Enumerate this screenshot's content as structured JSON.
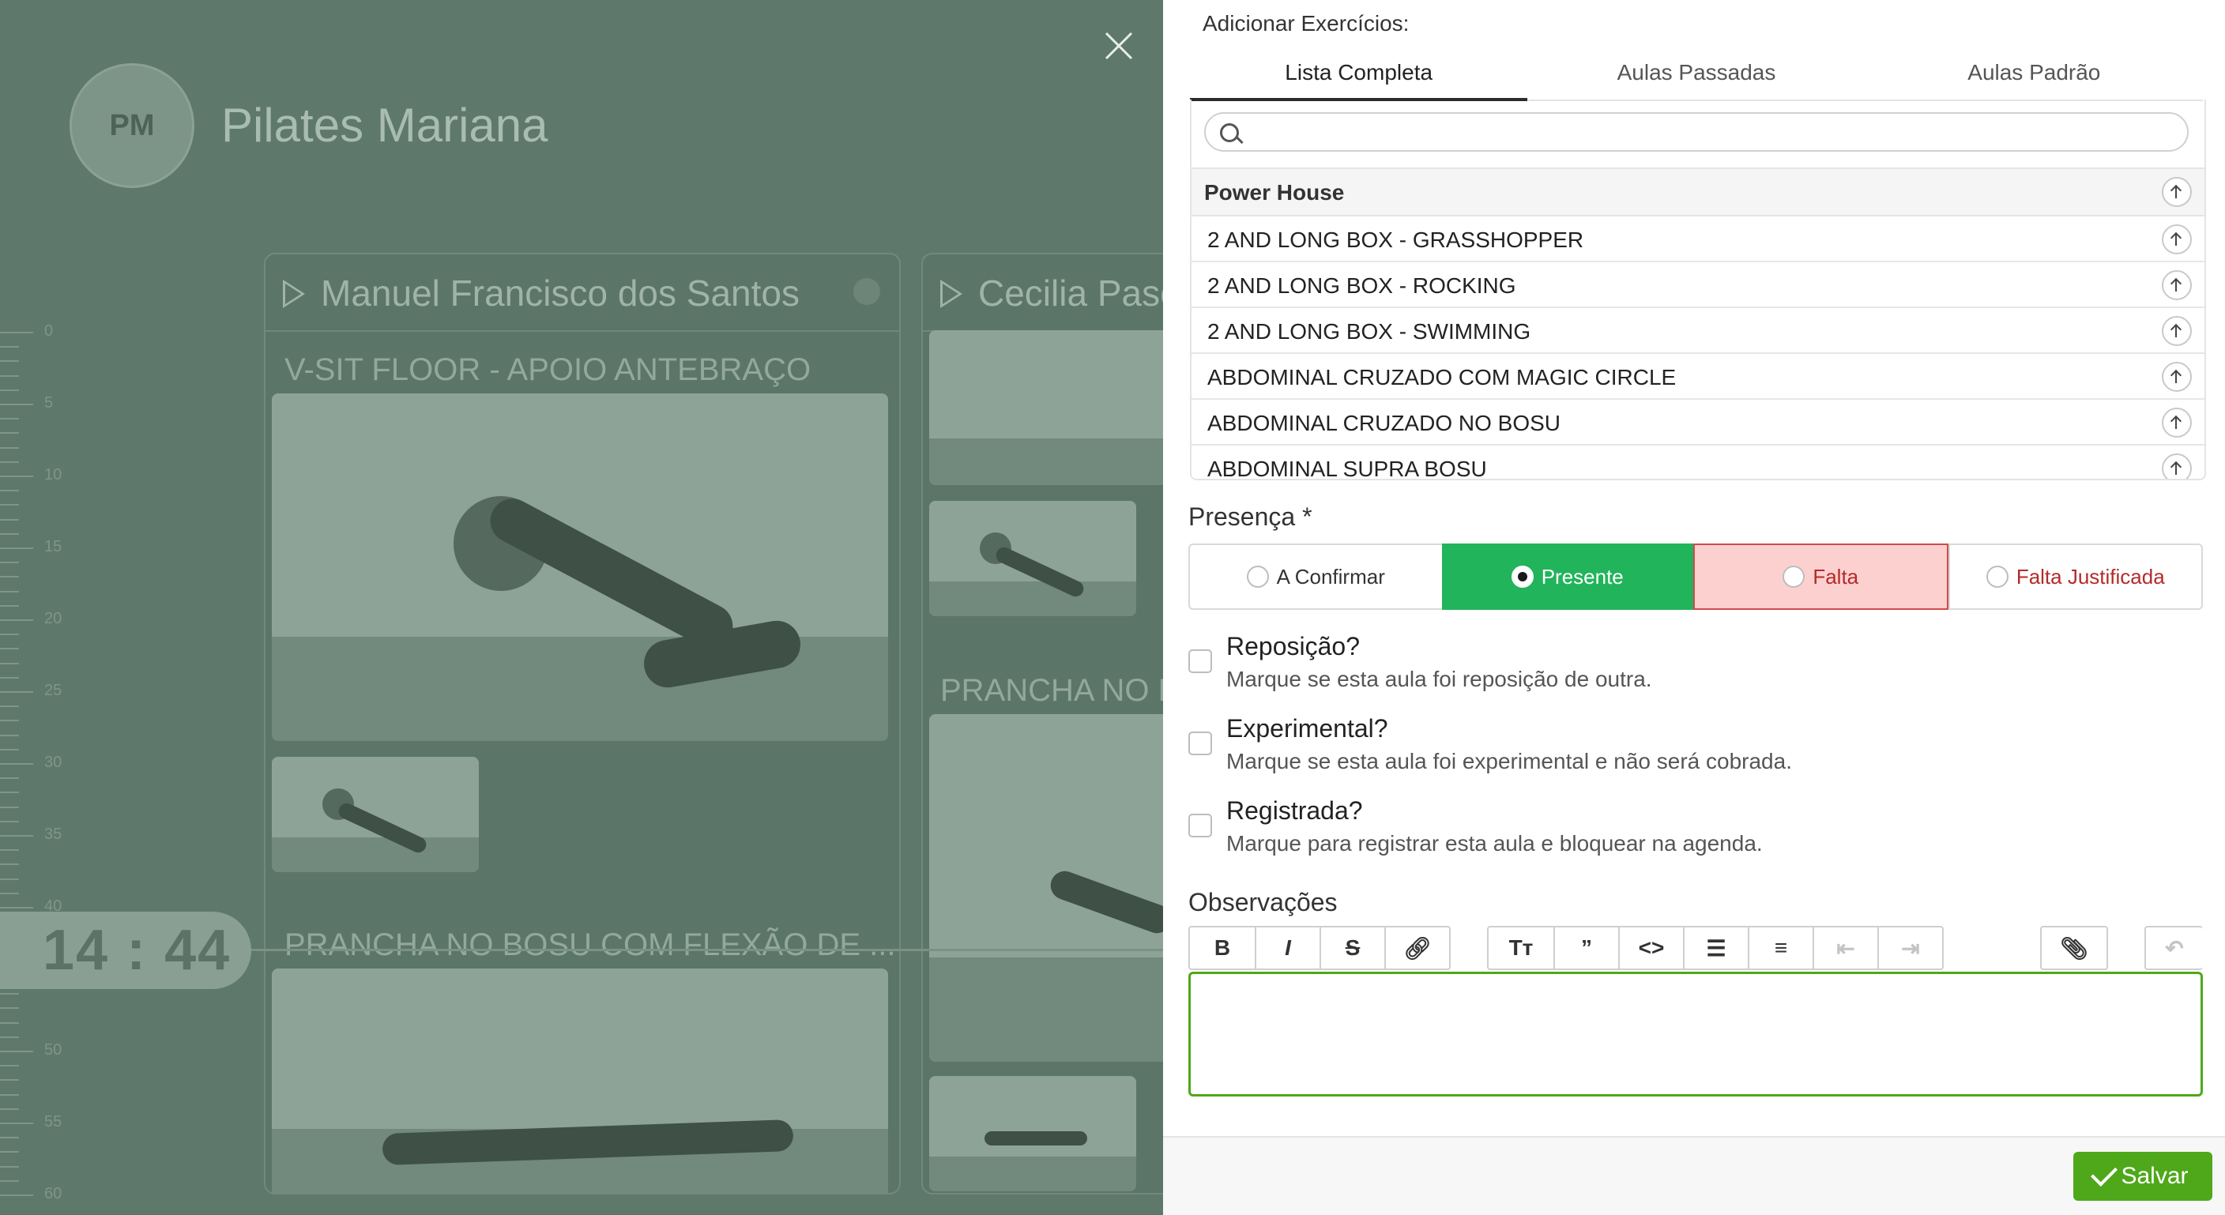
{
  "background": {
    "avatar_initials": "PM",
    "studio_name": "Pilates Mariana",
    "current_time": "14 : 44",
    "ruler_labels": [
      "0",
      "5",
      "10",
      "15",
      "20",
      "25",
      "30",
      "35",
      "40",
      "45",
      "50",
      "55",
      "60"
    ],
    "columns": [
      {
        "name": "Manuel Francisco dos Santos",
        "exercises": [
          "V-SIT FLOOR - APOIO ANTEBRAÇO",
          "PRANCHA NO BOSU COM FLEXÃO DE ..."
        ]
      },
      {
        "name": "Cecilia Pasc",
        "exercises": [
          "PRANCHA NO B"
        ]
      }
    ]
  },
  "panel": {
    "add_label": "Adicionar Exercícios:",
    "tabs": [
      {
        "label": "Lista Completa",
        "active": true
      },
      {
        "label": "Aulas Passadas",
        "active": false
      },
      {
        "label": "Aulas Padrão",
        "active": false
      }
    ],
    "search": {
      "value": "",
      "placeholder": ""
    },
    "group": "Power House",
    "exercises": [
      "2 AND LONG BOX - GRASSHOPPER",
      "2 AND LONG BOX - ROCKING",
      "2 AND LONG BOX - SWIMMING",
      "ABDOMINAL CRUZADO COM MAGIC CIRCLE",
      "ABDOMINAL CRUZADO NO BOSU",
      "ABDOMINAL SUPRA BOSU"
    ],
    "presence": {
      "label": "Presença *",
      "options": [
        "A Confirmar",
        "Presente",
        "Falta",
        "Falta Justificada"
      ],
      "selected": "Presente"
    },
    "checks": [
      {
        "title": "Reposição?",
        "description": "Marque se esta aula foi reposição de outra.",
        "checked": false
      },
      {
        "title": "Experimental?",
        "description": "Marque se esta aula foi experimental e não será cobrada.",
        "checked": false
      },
      {
        "title": "Registrada?",
        "description": "Marque para registrar esta aula e bloquear na agenda.",
        "checked": false
      }
    ],
    "notes_label": "Observações",
    "notes_value": "",
    "save_label": "Salvar",
    "accent_color": "#4ea81a",
    "presente_color": "#21b45b",
    "falta_color": "#fdd0d0"
  }
}
